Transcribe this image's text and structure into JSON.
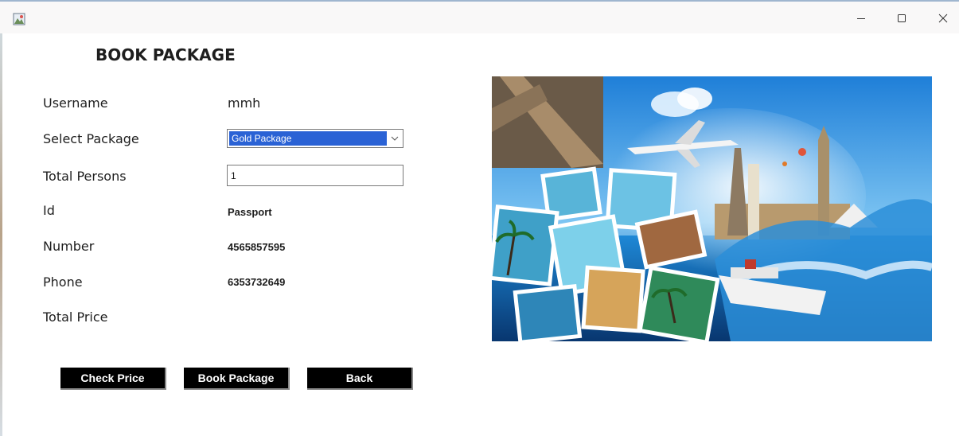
{
  "window": {
    "minimize_glyph": "—",
    "maximize_glyph": "☐",
    "close_glyph": "✕"
  },
  "form": {
    "title": "BOOK PACKAGE",
    "labels": {
      "username": "Username",
      "select_package": "Select Package",
      "total_persons": "Total Persons",
      "id": "Id",
      "number": "Number",
      "phone": "Phone",
      "total_price": "Total Price"
    },
    "values": {
      "username": "mmh",
      "package": "Gold Package",
      "total_persons": "1",
      "id": "Passport",
      "number": "4565857595",
      "phone": "6353732649",
      "total_price": ""
    }
  },
  "buttons": {
    "check_price": "Check Price",
    "book_package": "Book Package",
    "back": "Back"
  },
  "colors": {
    "selection_blue": "#2a62d5",
    "button_bg": "#000000",
    "button_text": "#ffffff"
  }
}
